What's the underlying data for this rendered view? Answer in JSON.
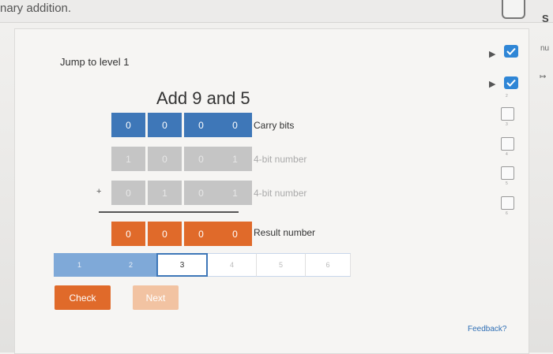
{
  "top": {
    "text": "nary addition.",
    "right_letter": "S"
  },
  "jump_label": "Jump to level 1",
  "problem_title": "Add 9 and 5",
  "rows": {
    "carry": {
      "bits": [
        "0",
        "0",
        "0",
        "0"
      ],
      "label": "Carry bits"
    },
    "number1": {
      "bits": [
        "1",
        "0",
        "0",
        "1"
      ],
      "label": "4-bit number"
    },
    "number2": {
      "bits": [
        "0",
        "1",
        "0",
        "1"
      ],
      "label": "4-bit number"
    },
    "result": {
      "bits": [
        "0",
        "0",
        "0",
        "0"
      ],
      "label": "Result number"
    },
    "operator": "+"
  },
  "progress": {
    "segments": [
      "1",
      "2",
      "3",
      "4",
      "5",
      "6"
    ],
    "current": 3
  },
  "buttons": {
    "check": "Check",
    "next": "Next"
  },
  "feedback": "Feedback?",
  "side_panel": {
    "checked_count": 2,
    "levels": [
      "2",
      "3",
      "4",
      "5",
      "6"
    ],
    "arrow": "▶"
  },
  "right_edge": {
    "text": "nu",
    "mark": "↦"
  },
  "colors": {
    "carry_blue": "#3e77b8",
    "input_gray": "#c5c5c5",
    "result_orange": "#e06a2a",
    "progress_done": "#7fa9d8",
    "check_blue": "#2f86d6"
  }
}
